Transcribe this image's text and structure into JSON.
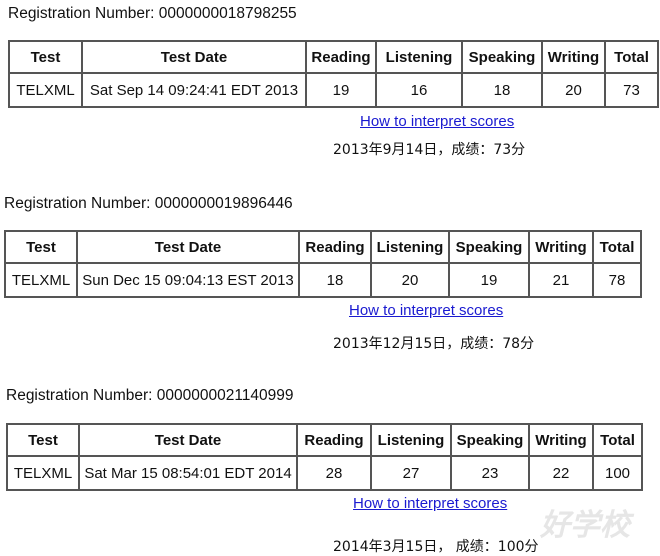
{
  "headers": [
    "Test",
    "Test Date",
    "Reading",
    "Listening",
    "Speaking",
    "Writing",
    "Total"
  ],
  "link_label": "How to interpret scores",
  "records": [
    {
      "registration": "Registration Number: 0000000018798255",
      "row": [
        "TELXML",
        "Sat Sep 14 09:24:41 EDT 2013",
        "19",
        "16",
        "18",
        "20",
        "73"
      ],
      "caption": "2013年9月14日，成绩：73分"
    },
    {
      "registration": "Registration Number: 0000000019896446",
      "row": [
        "TELXML",
        "Sun Dec 15 09:04:13 EST 2013",
        "18",
        "20",
        "19",
        "21",
        "78"
      ],
      "caption": "2013年12月15日，成绩：78分"
    },
    {
      "registration": "Registration Number: 0000000021140999",
      "row": [
        "TELXML",
        "Sat Mar 15 08:54:01 EDT 2014",
        "28",
        "27",
        "23",
        "22",
        "100"
      ],
      "caption": "2014年3月15日， 成绩：100分"
    }
  ],
  "watermark": "好学校"
}
